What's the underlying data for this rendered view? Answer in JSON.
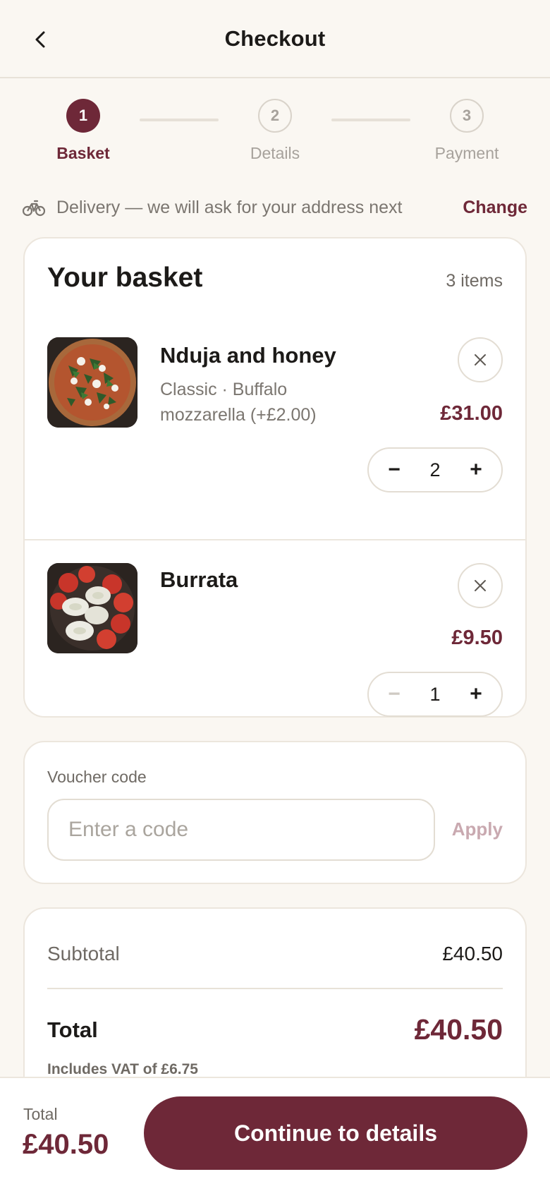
{
  "header": {
    "title": "Checkout",
    "back_icon": "chevron-left-icon"
  },
  "steps": [
    {
      "number": "1",
      "label": "Basket",
      "state": "active"
    },
    {
      "number": "2",
      "label": "Details",
      "state": "upcoming"
    },
    {
      "number": "3",
      "label": "Payment",
      "state": "upcoming"
    }
  ],
  "delivery": {
    "icon": "bicycle-icon",
    "text": "Delivery — we will ask for your address next",
    "change_label": "Change"
  },
  "basket": {
    "title": "Your basket",
    "count": "3 items",
    "items": [
      {
        "name": "Nduja and honey",
        "options": "Classic · Buffalo mozzarella (+£2.00)",
        "price": "£31.00",
        "quantity": "2",
        "decrease_symbol": "−",
        "increase_symbol": "+",
        "image": "pizza-photo"
      },
      {
        "name": "Burrata",
        "options": "",
        "price": "£9.50",
        "quantity": "1",
        "decrease_symbol": "−",
        "increase_symbol": "+",
        "image": "burrata-photo"
      }
    ]
  },
  "voucher": {
    "label": "Voucher code",
    "placeholder": "Enter a code",
    "value": "",
    "apply_label": "Apply"
  },
  "summary": {
    "subtotal_label": "Subtotal",
    "subtotal_value": "£40.50",
    "total_label": "Total",
    "total_value": "£40.50",
    "vat_note": "Includes VAT of £6.75"
  },
  "footer": {
    "total_label": "Total",
    "total_value": "£40.50",
    "continue_label": "Continue to details"
  },
  "colors": {
    "accent": "#6e2838",
    "background": "#faf7f2",
    "muted_text": "#7b7670",
    "border": "#ece6dd"
  }
}
